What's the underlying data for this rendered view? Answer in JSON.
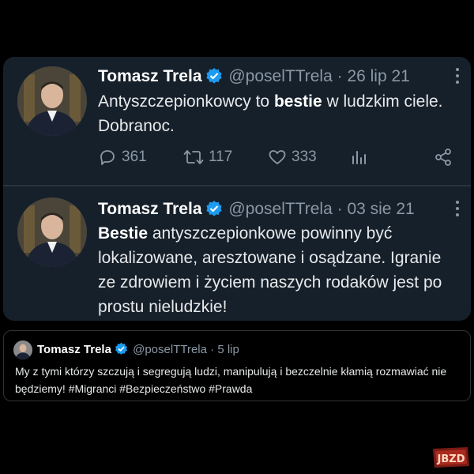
{
  "tweets": [
    {
      "name": "Tomasz Trela",
      "handle": "@poselTTrela",
      "separator": "·",
      "date": "26 lip 21",
      "text_parts": [
        {
          "text": "Antyszczepionkowcy to ",
          "bold": false
        },
        {
          "text": "bestie",
          "bold": true
        },
        {
          "text": " w ludzkim ciele. Dobranoc.",
          "bold": false
        }
      ],
      "replies": "361",
      "retweets": "117",
      "likes": "333"
    },
    {
      "name": "Tomasz Trela",
      "handle": "@poselTTrela",
      "separator": "·",
      "date": "03 sie 21",
      "text_parts": [
        {
          "text": "Bestie",
          "bold": true
        },
        {
          "text": " antyszczepionkowe powinny być lokalizowane, aresztowane i osądzane. Igranie ze zdrowiem i życiem naszych rodaków jest po prostu nieludzkie!",
          "bold": false
        }
      ]
    },
    {
      "name": "Tomasz Trela",
      "handle": "@poselTTrela",
      "separator": "·",
      "date": "5 lip",
      "text": "My z tymi którzy szczują i segregują ludzi, manipulują i bezczelnie kłamią rozmawiać nie będziemy! #Migranci #Bezpieczeństwo #Prawda"
    }
  ],
  "watermark": "JBZD",
  "colors": {
    "card_bg": "#16202b",
    "page_bg": "#000000",
    "muted": "#8b98a5",
    "verified": "#1d9bf0",
    "text": "#e7e9ea"
  },
  "icons": [
    "verified-badge-icon",
    "more-icon",
    "reply-icon",
    "retweet-icon",
    "like-icon",
    "analytics-icon",
    "share-icon"
  ]
}
